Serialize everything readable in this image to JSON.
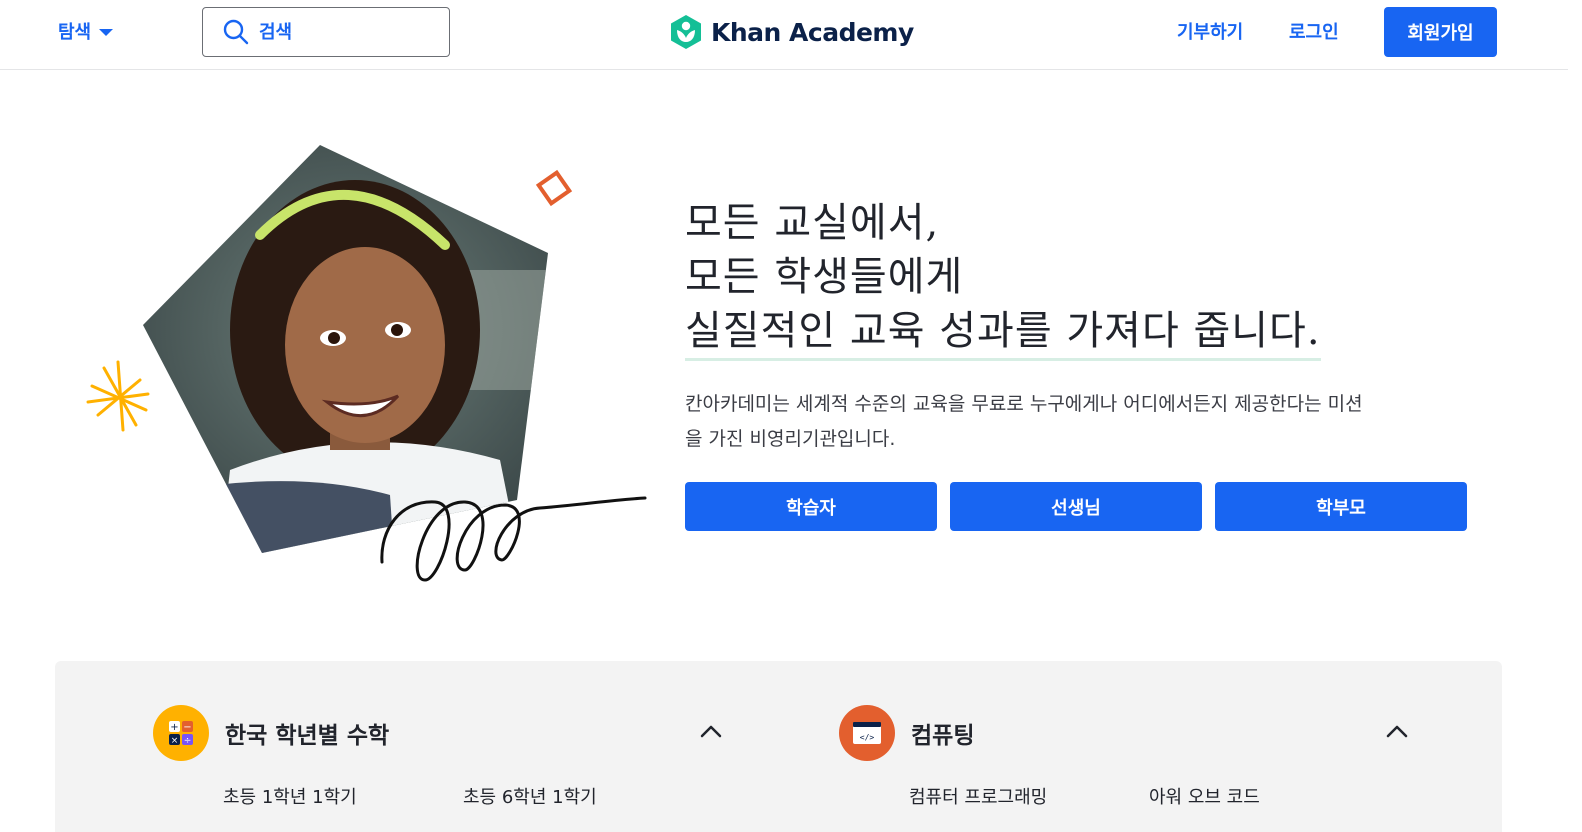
{
  "header": {
    "explore_label": "탐색",
    "search_placeholder": "검색",
    "logo_text": "Khan Academy",
    "donate_label": "기부하기",
    "login_label": "로그인",
    "signup_label": "회원가입"
  },
  "hero": {
    "headline_line1": "모든 교실에서,",
    "headline_line2": "모든 학생들에게",
    "headline_line3": "실질적인 교육 성과를 가져다 줍니다.",
    "description": "칸아카데미는 세계적 수준의 교육을 무료로 누구에게나 어디에서든지 제공한다는 미션을 가진 비영리기관입니다.",
    "roles": [
      "학습자",
      "선생님",
      "학부모"
    ]
  },
  "subjects": [
    {
      "title": "한국 학년별 수학",
      "icon": "math-operations-icon",
      "links": [
        "초등 1학년 1학기",
        "초등 6학년 1학기"
      ]
    },
    {
      "title": "컴퓨팅",
      "icon": "code-window-icon",
      "links": [
        "컴퓨터 프로그래밍",
        "아워 오브 코드"
      ]
    }
  ],
  "colors": {
    "brand_blue": "#1865f2",
    "logo_green": "#14bf96",
    "math_yellow": "#ffb100",
    "computing_orange": "#e35f2e"
  }
}
